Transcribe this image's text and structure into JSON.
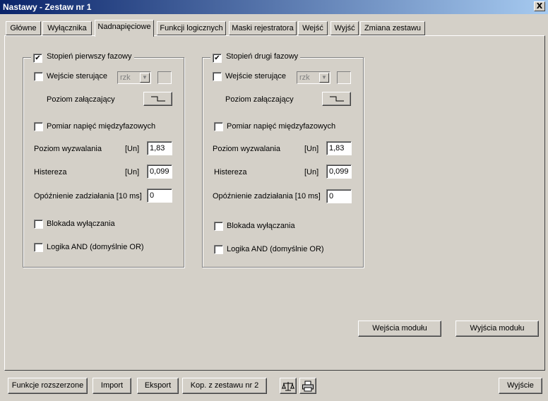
{
  "window": {
    "title": "Nastawy  -  Zestaw nr 1",
    "close_label": "X"
  },
  "tabs": [
    {
      "label": "Główne"
    },
    {
      "label": "Wyłącznika"
    },
    {
      "label": "Nadnapięciowe",
      "active": true
    },
    {
      "label": "Funkcji logicznych"
    },
    {
      "label": "Maski rejestratora"
    },
    {
      "label": "Wejść"
    },
    {
      "label": "Wyjść"
    },
    {
      "label": "Zmiana zestawu"
    }
  ],
  "stage1": {
    "title": "Stopień pierwszy fazowy",
    "enabled": true,
    "control_input_label": "Wejście sterujące",
    "control_input_checked": false,
    "combo_value": "rzk",
    "activation_level_label": "Poziom załączający",
    "phase_voltage_label": "Pomiar napięć międzyfazowych",
    "phase_voltage_checked": false,
    "trigger_level_label": "Poziom wyzwalania",
    "trigger_level_unit": "[Un]",
    "trigger_level_value": "1,83",
    "hysteresis_label": "Histereza",
    "hysteresis_unit": "[Un]",
    "hysteresis_value": "0,099",
    "delay_label": "Opóźnienie zadziałania  [10 ms]",
    "delay_value": "0",
    "block_label": "Blokada wyłączania",
    "block_checked": false,
    "logic_label": "Logika AND (domyślnie OR)",
    "logic_checked": false
  },
  "stage2": {
    "title": "Stopień drugi fazowy",
    "enabled": true,
    "control_input_label": "Wejście sterujące",
    "control_input_checked": false,
    "combo_value": "rzk",
    "activation_level_label": "Poziom załączający",
    "phase_voltage_label": "Pomiar napięć międzyfazowych",
    "phase_voltage_checked": false,
    "trigger_level_label": "Poziom wyzwalania",
    "trigger_level_unit": "[Un]",
    "trigger_level_value": "1,83",
    "hysteresis_label": "Histereza",
    "hysteresis_unit": "[Un]",
    "hysteresis_value": "0,099",
    "delay_label": "Opóźnienie zadziałania  [10 ms]",
    "delay_value": "0",
    "block_label": "Blokada wyłączania",
    "block_checked": false,
    "logic_label": "Logika AND (domyślnie OR)",
    "logic_checked": false
  },
  "module_buttons": {
    "inputs": "Wejścia modułu",
    "outputs": "Wyjścia modułu"
  },
  "footer": {
    "extended": "Funkcje rozszerzone",
    "import": "Import",
    "export": "Eksport",
    "copy": "Kop. z zestawu nr 2",
    "exit": "Wyjście"
  },
  "icons": {
    "compare": "scales-icon",
    "print": "printer-icon"
  }
}
